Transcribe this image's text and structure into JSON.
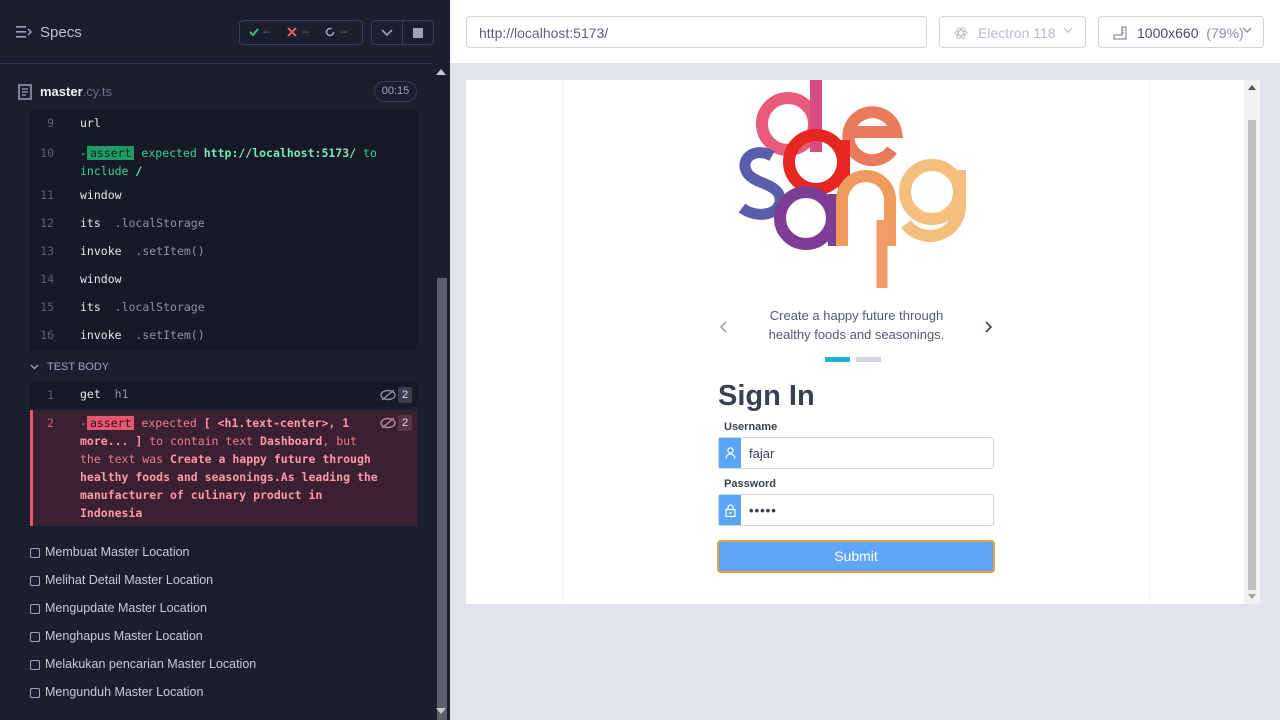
{
  "runner": {
    "specs_title": "Specs",
    "stats": {
      "passed": "--",
      "failed": "--",
      "pending": "--"
    },
    "file": {
      "name": "master",
      "ext": ".cy.ts",
      "duration": "00:15"
    },
    "commands": [
      {
        "num": "9",
        "name": "url",
        "args": ""
      },
      {
        "num": "11",
        "name": "window",
        "args": ""
      },
      {
        "num": "12",
        "name": "its",
        "args": ".localStorage"
      },
      {
        "num": "13",
        "name": "invoke",
        "args": ".setItem()"
      },
      {
        "num": "14",
        "name": "window",
        "args": ""
      },
      {
        "num": "15",
        "name": "its",
        "args": ".localStorage"
      },
      {
        "num": "16",
        "name": "invoke",
        "args": ".setItem()"
      }
    ],
    "assert_10": {
      "num": "10",
      "dash": "-",
      "badge": "assert",
      "expected": "expected",
      "url": "http://localhost:5173/",
      "to": "to",
      "include": "include",
      "slash": "/"
    },
    "test_body_label": "TEST BODY",
    "get_cmd": {
      "num": "1",
      "name": "get",
      "args": "h1",
      "count": "2"
    },
    "fail_assert": {
      "num": "2",
      "count": "2",
      "dash": "-",
      "badge": "assert",
      "expected": "expected",
      "subject": "[ <h1.text-center>, 1 more... ]",
      "to_contain": "to contain text",
      "target": "Dashboard",
      "comma": ",",
      "but": "but the text was",
      "actual": "Create a happy future through healthy foods and seasonings.As leading the manufacturer of culinary product in Indonesia"
    },
    "tests": [
      "Membuat Master Location",
      "Melihat Detail Master Location",
      "Mengupdate Master Location",
      "Menghapus Master Location",
      "Melakukan pencarian Master Location",
      "Mengunduh Master Location"
    ]
  },
  "browser": {
    "url": "http://localhost:5173/",
    "name": "Electron 118",
    "viewport": "1000x660",
    "scale": "(79%)"
  },
  "app": {
    "logo_text": "daesang",
    "tagline": "Create a happy future through healthy foods and seasonings.",
    "signin_title": "Sign In",
    "username_label": "Username",
    "username_value": "fajar",
    "password_label": "Password",
    "password_value": "•••••",
    "submit_label": "Submit",
    "colors": {
      "accent": "#60a5f7",
      "active_dot": "#1fb3d8",
      "fail": "#e45770",
      "pass": "#1e9b67"
    }
  }
}
